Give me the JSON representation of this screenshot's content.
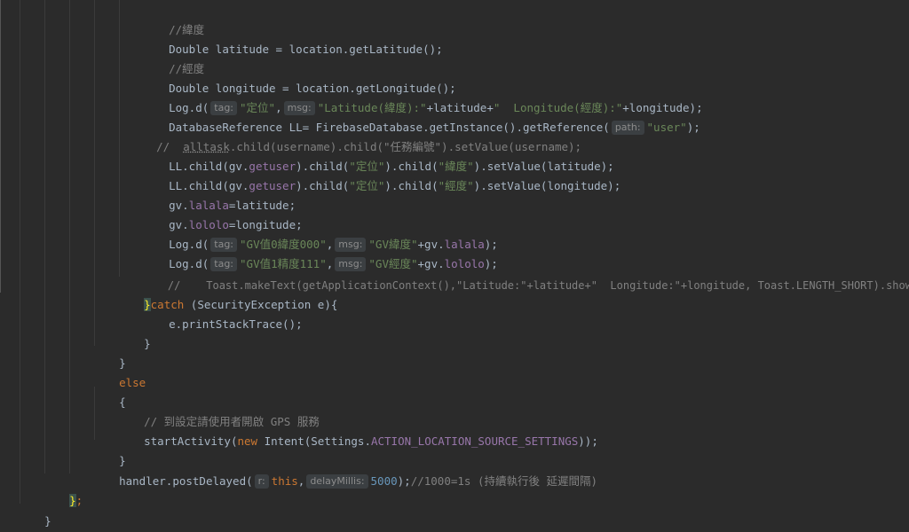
{
  "editor": {
    "lines": {
      "l1": "//緯度",
      "l2_a": "Double latitude = location.getLatitude();",
      "l3": "//經度",
      "l4_a": "Double longitude = location.getLongitude();",
      "l5_a": "Log.d(",
      "l5_hint_tag": "tag:",
      "l5_str1": "\"定位\"",
      "l5_comma": ",",
      "l5_hint_msg": "msg:",
      "l5_str2": "\"Latitude(緯度):\"",
      "l5_b": "+latitude+",
      "l5_str3": "\"  Longitude(經度):\"",
      "l5_c": "+longitude);",
      "l6_a": "DatabaseReference LL= FirebaseDatabase.getInstance().getReference(",
      "l6_hint_path": "path:",
      "l6_str": "\"user\"",
      "l6_b": ");",
      "l7_prefix": "//  ",
      "l7_alltask": "alltask",
      "l7_rest": ".child(username).child(\"任務編號\").setValue(username);",
      "l8_a": "LL.child(gv.",
      "l8_field": "getuser",
      "l8_b": ").child(",
      "l8_str1": "\"定位\"",
      "l8_c": ").child(",
      "l8_str2": "\"緯度\"",
      "l8_d": ").setValue(latitude);",
      "l9_a": "LL.child(gv.",
      "l9_field": "getuser",
      "l9_b": ").child(",
      "l9_str1": "\"定位\"",
      "l9_c": ").child(",
      "l9_str2": "\"經度\"",
      "l9_d": ").setValue(longitude);",
      "l10_a": "gv.",
      "l10_field": "lalala",
      "l10_b": "=latitude;",
      "l11_a": "gv.",
      "l11_field": "lololo",
      "l11_b": "=longitude;",
      "l12_a": "Log.d(",
      "l12_hint_tag": "tag:",
      "l12_str1": "\"GV值0緯度000\"",
      "l12_comma": ",",
      "l12_hint_msg": "msg:",
      "l12_str2": "\"GV緯度\"",
      "l12_b": "+gv.",
      "l12_field": "lalala",
      "l12_c": ");",
      "l13_a": "Log.d(",
      "l13_hint_tag": "tag:",
      "l13_str1": "\"GV值1精度111\"",
      "l13_comma": ",",
      "l13_hint_msg": "msg:",
      "l13_str2": "\"GV經度\"",
      "l13_b": "+gv.",
      "l13_field": "lololo",
      "l13_c": ");",
      "l14": "//    Toast.makeText(getApplicationContext(),\"Latitude:\"+latitude+\"  Longitude:\"+longitude, Toast.LENGTH_SHORT).show();",
      "l15_brace": "}",
      "l15_kw": "catch",
      "l15_rest": " (SecurityException e){",
      "l16": "e.printStackTrace();",
      "l17": "}",
      "l18": "}",
      "l19": "else",
      "l20": "{",
      "l21": "// 到設定請使用者開啟 GPS 服務",
      "l22_a": "startActivity(",
      "l22_kw": "new",
      "l22_b": " Intent(Settings.",
      "l22_field": "ACTION_LOCATION_SOURCE_SETTINGS",
      "l22_c": "));",
      "l23": "}",
      "l24_a": "handler.postDelayed(",
      "l24_hint_r": "r:",
      "l24_kw": "this",
      "l24_comma": ",",
      "l24_hint_delay": "delayMillis:",
      "l24_num": "5000",
      "l24_b": ");",
      "l24_comment": "//1000=1s (持續執行後 延遲間隔)",
      "l25_brace": "}",
      "l25_semi": ";",
      "l26": "}"
    }
  }
}
